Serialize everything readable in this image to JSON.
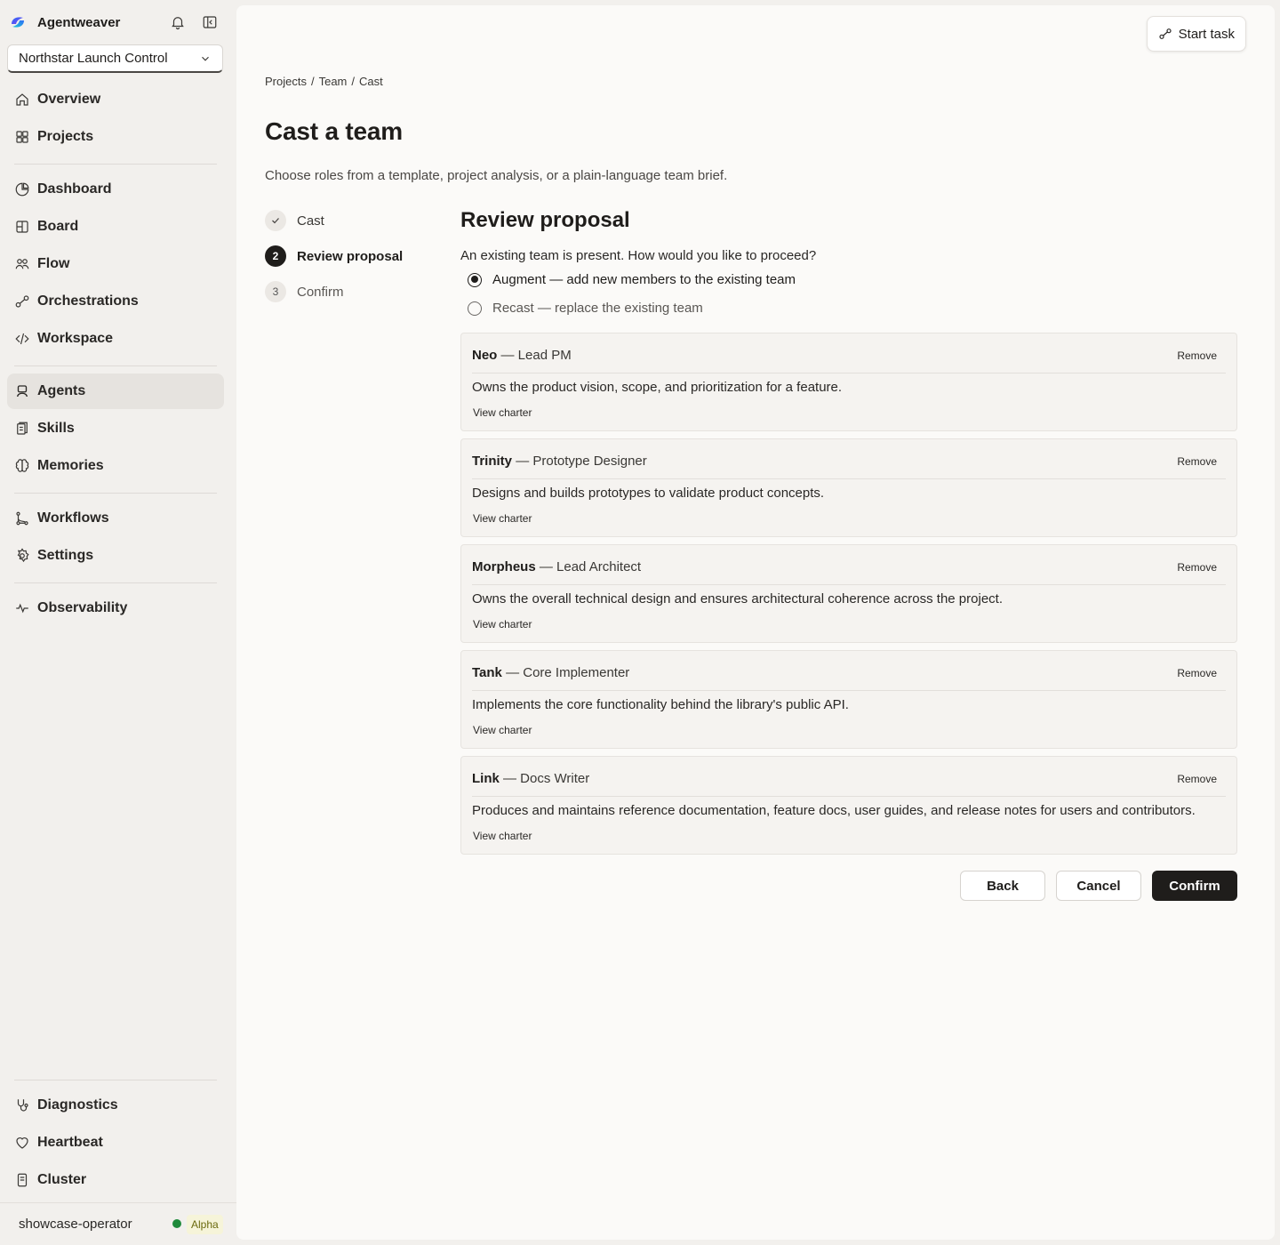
{
  "app": {
    "name": "Agentweaver",
    "project_select": "Northstar Launch Control"
  },
  "nav": {
    "group1": [
      "Overview",
      "Projects"
    ],
    "group2": [
      "Dashboard",
      "Board",
      "Flow",
      "Orchestrations",
      "Workspace"
    ],
    "group3": [
      "Agents",
      "Skills",
      "Memories"
    ],
    "group4": [
      "Workflows",
      "Settings"
    ],
    "group5": [
      "Observability"
    ],
    "bottom": [
      "Diagnostics",
      "Heartbeat",
      "Cluster"
    ],
    "active": "Agents"
  },
  "user": {
    "name": "showcase-operator",
    "badge": "Alpha",
    "status_color": "#1f8a3b"
  },
  "header": {
    "start_task": "Start task"
  },
  "breadcrumb": [
    "Projects",
    "/",
    "Team",
    "/",
    "Cast"
  ],
  "page": {
    "title": "Cast a team",
    "description": "Choose roles from a template, project analysis, or a plain-language team brief."
  },
  "steps": [
    {
      "num": "",
      "label": "Cast",
      "state": "done"
    },
    {
      "num": "2",
      "label": "Review proposal",
      "state": "current"
    },
    {
      "num": "3",
      "label": "Confirm",
      "state": "todo"
    }
  ],
  "review": {
    "title": "Review proposal",
    "question": "An existing team is present. How would you like to proceed?",
    "options": [
      {
        "label": "Augment — add new members to the existing team",
        "checked": true
      },
      {
        "label": "Recast — replace the existing team",
        "checked": false
      }
    ]
  },
  "members": [
    {
      "name": "Neo",
      "role": "— Lead PM",
      "desc": "Owns the product vision, scope, and prioritization for a feature.",
      "remove": "Remove",
      "link": "View charter"
    },
    {
      "name": "Trinity",
      "role": "— Prototype Designer",
      "desc": "Designs and builds prototypes to validate product concepts.",
      "remove": "Remove",
      "link": "View charter"
    },
    {
      "name": "Morpheus",
      "role": "— Lead Architect",
      "desc": "Owns the overall technical design and ensures architectural coherence across the project.",
      "remove": "Remove",
      "link": "View charter"
    },
    {
      "name": "Tank",
      "role": "— Core Implementer",
      "desc": "Implements the core functionality behind the library's public API.",
      "remove": "Remove",
      "link": "View charter"
    },
    {
      "name": "Link",
      "role": "— Docs Writer",
      "desc": "Produces and maintains reference documentation, feature docs, user guides, and release notes for users and contributors.",
      "remove": "Remove",
      "link": "View charter"
    }
  ],
  "actions": {
    "back": "Back",
    "cancel": "Cancel",
    "confirm": "Confirm"
  }
}
